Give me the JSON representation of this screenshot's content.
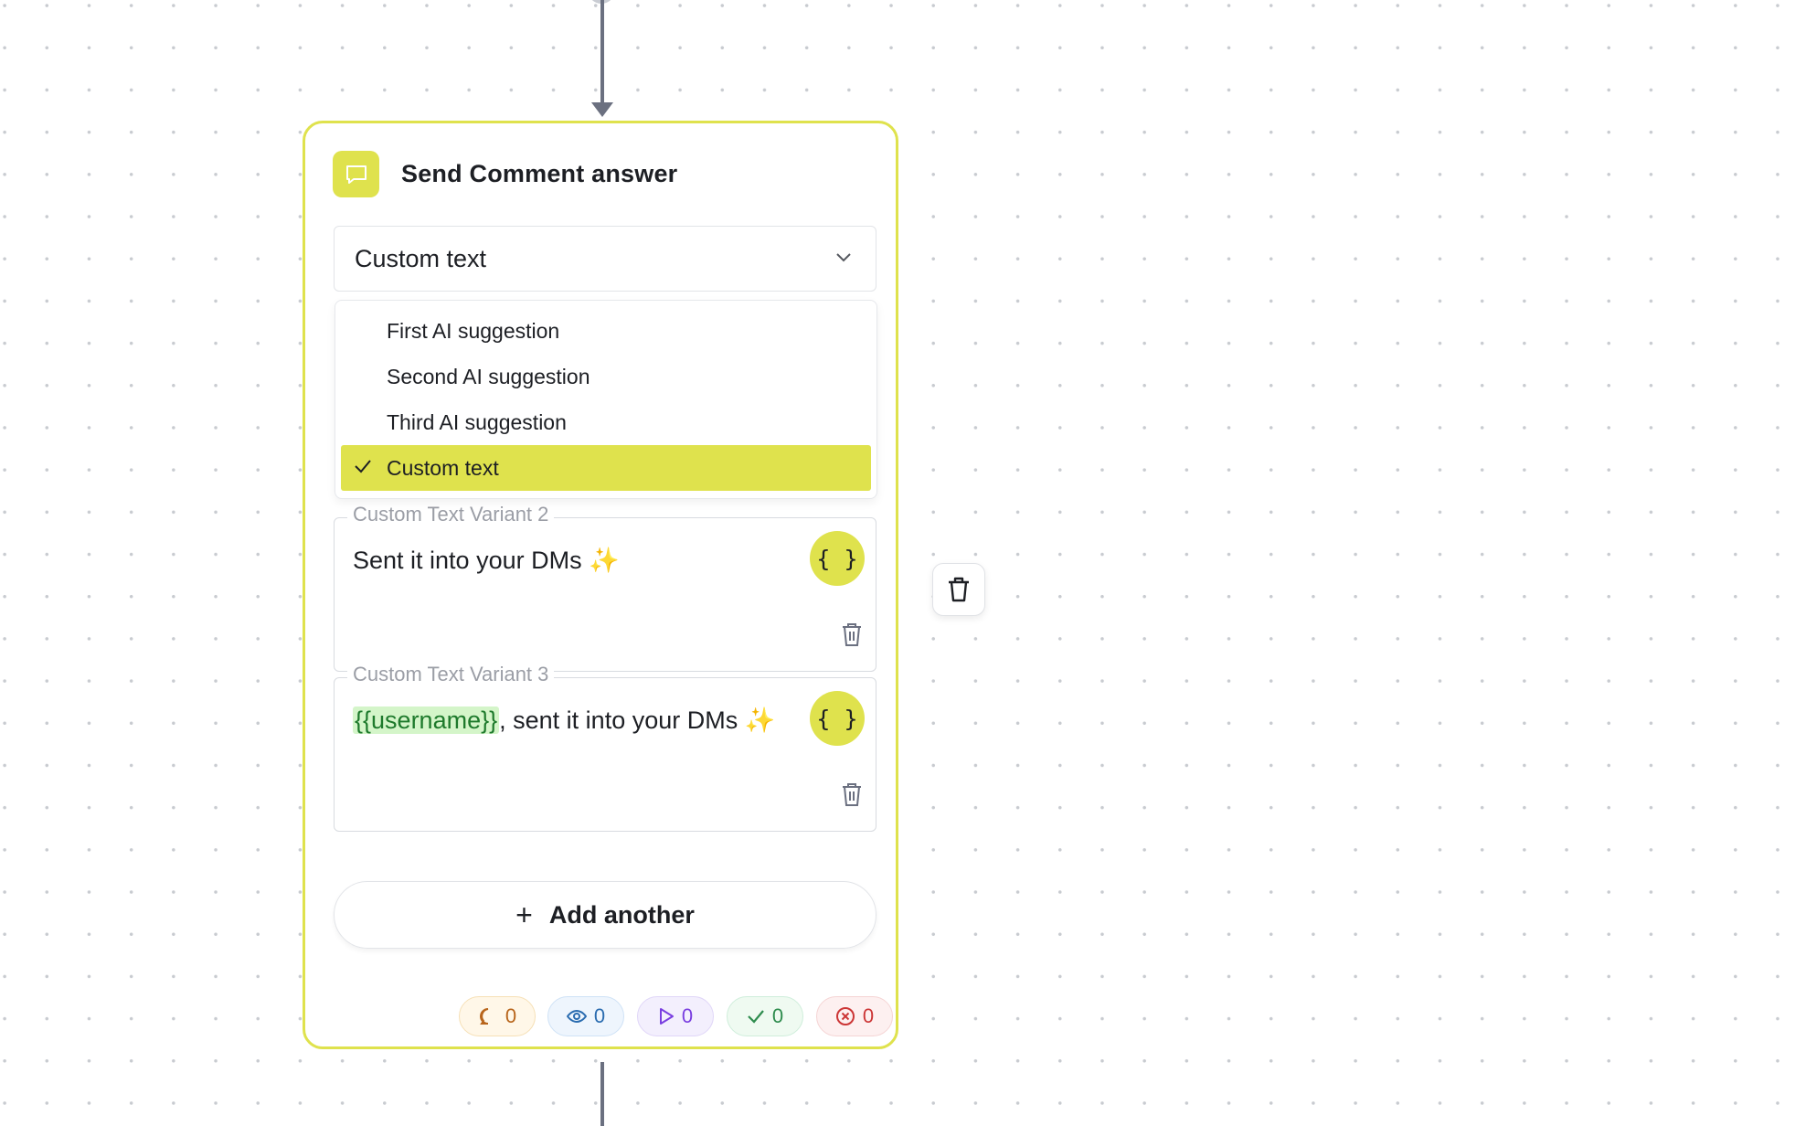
{
  "node": {
    "title": "Send Comment answer",
    "icon": "chat-bubble-icon"
  },
  "select": {
    "value": "Custom text",
    "options": [
      "First AI suggestion",
      "Second AI suggestion",
      "Third AI suggestion",
      "Custom text"
    ],
    "selected_index": 3
  },
  "variants": [
    {
      "legend": "Custom Text Variant 2",
      "text": "Sent it into your DMs",
      "emoji": "✨",
      "var_button": "{ }"
    },
    {
      "legend": "Custom Text Variant 3",
      "token": "{{username}}",
      "text": ", sent it into your DMs",
      "emoji": "✨",
      "var_button": "{ }"
    }
  ],
  "add_button": {
    "label": "Add another",
    "icon": "+"
  },
  "stats": [
    {
      "icon": "comment-icon",
      "value": "0",
      "color": "#b8651b",
      "bg": "#fff7e8",
      "border": "#f6e0b6"
    },
    {
      "icon": "eye-icon",
      "value": "0",
      "color": "#2a6cb0",
      "bg": "#eef5fd",
      "border": "#cfe2f6"
    },
    {
      "icon": "play-icon",
      "value": "0",
      "color": "#7a3fe0",
      "bg": "#f3effd",
      "border": "#e0d6f8"
    },
    {
      "icon": "check-icon",
      "value": "0",
      "color": "#2e8c4e",
      "bg": "#effaf1",
      "border": "#cfeedb"
    },
    {
      "icon": "x-circle-icon",
      "value": "0",
      "color": "#cc3636",
      "bg": "#fdf0f0",
      "border": "#f5d4d4"
    }
  ],
  "colors": {
    "accent": "#dfe24d",
    "connector": "#6b7080"
  }
}
